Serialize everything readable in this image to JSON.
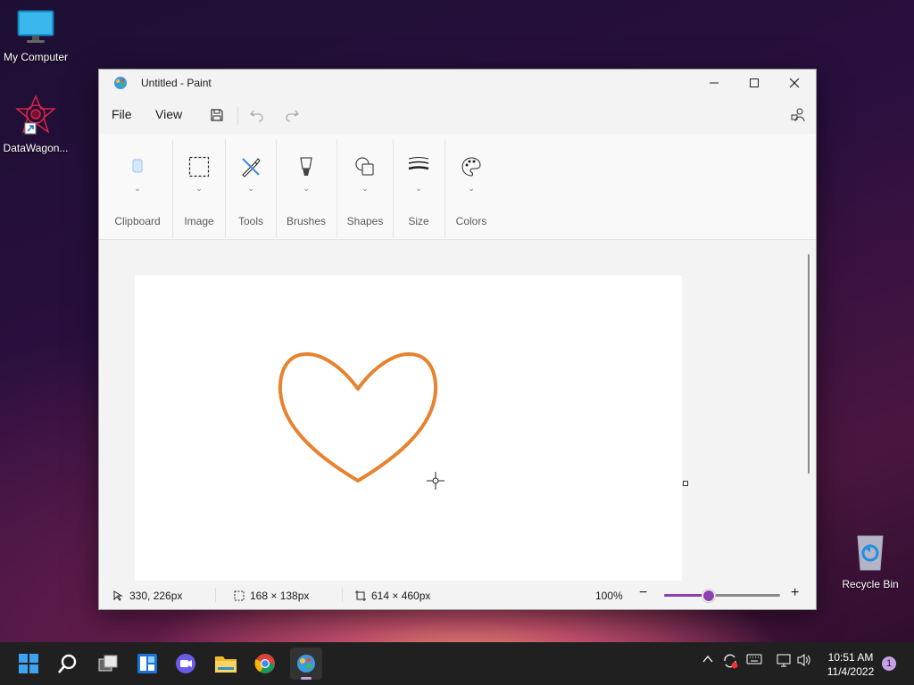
{
  "desktop": {
    "icons": [
      {
        "label": "My Computer",
        "icon": "monitor-icon"
      },
      {
        "label": "DataWagon...",
        "icon": "datawagon-icon"
      },
      {
        "label": "Recycle Bin",
        "icon": "recycle-bin-icon"
      }
    ]
  },
  "window": {
    "title": "Untitled - Paint",
    "app_icon": "paint-icon",
    "menu": {
      "file": "File",
      "view": "View"
    },
    "toolbar_icons": [
      "save-icon",
      "undo-icon",
      "redo-icon",
      "account-icon"
    ]
  },
  "ribbon": {
    "groups": [
      {
        "label": "Clipboard",
        "icon": "clipboard-icon"
      },
      {
        "label": "Image",
        "icon": "selection-icon"
      },
      {
        "label": "Tools",
        "icon": "tools-icon"
      },
      {
        "label": "Brushes",
        "icon": "brush-icon"
      },
      {
        "label": "Shapes",
        "icon": "shapes-icon"
      },
      {
        "label": "Size",
        "icon": "size-icon"
      },
      {
        "label": "Colors",
        "icon": "palette-icon"
      }
    ]
  },
  "canvas": {
    "shape": "heart",
    "stroke_color": "#e8822e"
  },
  "status": {
    "cursor_pos": "330, 226px",
    "selection_size": "168 × 138px",
    "canvas_size": "614 × 460px",
    "zoom": "100%",
    "zoom_level_fraction": 0.38
  },
  "taskbar": {
    "apps": [
      "windows-start-icon",
      "search-icon",
      "task-view-icon",
      "widgets-icon",
      "chat-icon",
      "file-explorer-icon",
      "chrome-icon",
      "paint-icon"
    ],
    "time": "10:51 AM",
    "date": "11/4/2022",
    "notification_count": "1"
  },
  "colors": {
    "accent": "#8e3fb0",
    "heart": "#e8822e"
  }
}
